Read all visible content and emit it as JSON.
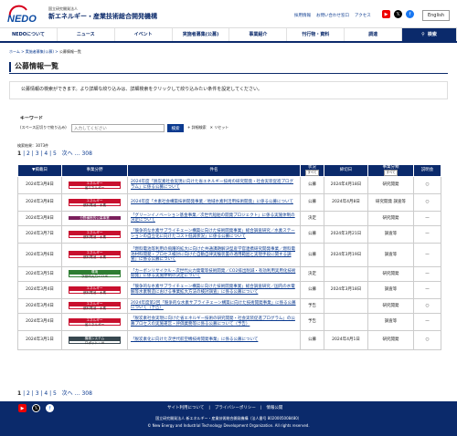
{
  "header": {
    "logo": "NEDO",
    "org_sub": "国立研究開発法人",
    "org_name": "新エネルギー・産業技術総合開発機構",
    "links": [
      "採用情報",
      "お問い合わせ窓口",
      "アクセス"
    ],
    "lang": "English"
  },
  "nav": {
    "items": [
      "NEDOについて",
      "ニュース",
      "イベント",
      "実施者募集(公募)",
      "事業紹介",
      "刊行物・資料",
      "調達"
    ],
    "search": "検索"
  },
  "breadcrumb": {
    "home": "ホーム",
    "parent": "実施者募集(公募)",
    "current": "公募情報一覧"
  },
  "page_title": "公募情報一覧",
  "intro": "公募情報の検索ができます。より詳細な絞り込みは、詳細検索をクリックして絞り込みたい条件を設定してください。",
  "keyword": {
    "label": "キーワード",
    "caption": "(スペース区切りで絞り込み)",
    "placeholder": "入力してください",
    "button": "検索",
    "advanced": "詳細検索",
    "reset": "リセット"
  },
  "result_count": "検索結果：3073件",
  "pager": {
    "current": "1",
    "pages": [
      "2",
      "3",
      "4",
      "5"
    ],
    "next": "次へ",
    "last": "308"
  },
  "table": {
    "headers": [
      "掲載日",
      "事業分野",
      "件名",
      "状況",
      "締切日",
      "事業分類",
      "説明会"
    ],
    "filter_value": "すべて",
    "rows": [
      {
        "date": "2024年3月8日",
        "tags": [
          {
            "l1": "エネルギー",
            "l2": "省エネルギー",
            "bg": "#c8102e"
          }
        ],
        "title": "2024年度「脱炭素社会実現に向けた省エネルギー技術の研究開発・社会実装促進プログラム」に係る公募について",
        "status": "公募",
        "deadline": "2024年4月18日",
        "category": "研究開発",
        "briefing": "○"
      },
      {
        "date": "2024年3月8日",
        "tags": [
          {
            "l1": "エネルギー",
            "l2": "燃料電池・水素",
            "bg": "#c8102e"
          }
        ],
        "title": "2024年度「水素社会構築技術開発事業／地域水素利活用技術開発」に係る公募について",
        "status": "公募",
        "deadline": "2024年4月8日",
        "category": "研究開発 調査等",
        "briefing": "○"
      },
      {
        "date": "2024年3月8日",
        "tags": [
          {
            "l1": "分野横断的公募事業",
            "l2": "",
            "bg": "#7a1f5c"
          }
        ],
        "title": "「グリーンイノベーション基金事業／次世代船舶の開発プロジェクト」に係る実施体制の決定について",
        "status": "決定",
        "deadline": "",
        "category": "研究開発",
        "briefing": "—"
      },
      {
        "date": "2024年3月7日",
        "tags": [
          {
            "l1": "エネルギー",
            "l2": "燃料電池・水素",
            "bg": "#c8102e"
          }
        ],
        "title": "「競争的な水素サプライチェーン構築に向けた技術開発事業」総合調査研究／水素ステーションの自立化に向けたコスト低減状況」に係る公募について",
        "status": "公募",
        "deadline": "2024年3月21日",
        "category": "調査等",
        "briefing": "—"
      },
      {
        "date": "2024年3月6日",
        "tags": [
          {
            "l1": "エネルギー",
            "l2": "燃料電池・水素",
            "bg": "#c8102e"
          }
        ],
        "title": "「燃料電池等利用の飛躍的拡大に向けた共通課題解決型産学官連携研究開発事業／燃料電池材料開発・プロセス検討に向けた自動自律実験装置の適用範囲と実現手段に関する調査」に係る公募について",
        "status": "公募",
        "deadline": "2024年3月19日",
        "category": "調査等",
        "briefing": "—"
      },
      {
        "date": "2024年3月5日",
        "tags": [
          {
            "l1": "環境",
            "l2": "次世代火力·CCUS",
            "bg": "#2e7d32"
          }
        ],
        "title": "「カーボンリサイクル・次世代火力発電等技術開発／CO2排出削減・有効利用実用化技術開発」に係る実施体制の決定について",
        "status": "決定",
        "deadline": "",
        "category": "研究開発",
        "briefing": "—"
      },
      {
        "date": "2024年3月4日",
        "tags": [
          {
            "l1": "エネルギー",
            "l2": "燃料電池・水素",
            "bg": "#c8102e"
          }
        ],
        "title": "「競争的な水素サプライチェーン構築に向けた技術開発事業」総合調査研究／国内の水電解等水素製造における事業拡大方法の検討調査」に係る公募について",
        "status": "公募",
        "deadline": "2024年3月18日",
        "category": "調査等",
        "briefing": "—"
      },
      {
        "date": "2024年3月4日",
        "tags": [
          {
            "l1": "エネルギー",
            "l2": "燃料電池・水素",
            "bg": "#c8102e"
          }
        ],
        "title": "2024年度第2回「競争的な水素サプライチェーン構築に向けた技術開発事業」に係る公募について（予告）",
        "status": "予告",
        "deadline": "",
        "category": "研究開発",
        "briefing": "○"
      },
      {
        "date": "2024年3月4日",
        "tags": [
          {
            "l1": "エネルギー",
            "l2": "省エネルギー",
            "bg": "#c8102e"
          }
        ],
        "title": "「脱炭素社会実現に向けた省エネルギー技術の研究開発・社会実装促進プログラム」の公募プロセスの実施運営・評価業務等に係る公募について（予告）",
        "status": "予告",
        "deadline": "",
        "category": "調査等",
        "briefing": "—"
      },
      {
        "date": "2024年3月1日",
        "tags": [
          {
            "l1": "機械システム",
            "l2": "ロボット・AI",
            "bg": "#37474f"
          }
        ],
        "title": "「脱炭素化に向けた次世代航空機技術開発事業」に係る公募について",
        "status": "公募",
        "deadline": "2024年4月1日",
        "category": "研究開発",
        "briefing": "○"
      }
    ]
  },
  "footer": {
    "links": [
      "サイト利用について",
      "プライバシーポリシー",
      "情報公開"
    ],
    "address": "国立研究開発法人 新エネルギー・産業技術総合開発機構（法人番号 8020005008480）",
    "copyright": "© New Energy and Industrial Technology Development Organization. All rights reserved."
  },
  "colors": {
    "brand": "#0b2a6b",
    "link": "#0b3a8f",
    "energy": "#c8102e",
    "environment": "#2e7d32",
    "cross": "#7a1f5c",
    "machine": "#37474f"
  }
}
